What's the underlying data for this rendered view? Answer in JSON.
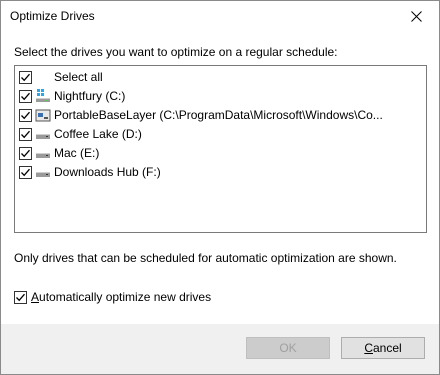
{
  "window": {
    "title": "Optimize Drives"
  },
  "dialog": {
    "instruction": "Select the drives you want to optimize on a regular schedule:",
    "select_all": {
      "label": "Select all",
      "checked": true
    },
    "drives": [
      {
        "label": "Nightfury (C:)",
        "icon": "windows-drive-icon",
        "checked": true
      },
      {
        "label": "PortableBaseLayer (C:\\ProgramData\\Microsoft\\Windows\\Co...",
        "icon": "portable-drive-icon",
        "checked": true
      },
      {
        "label": "Coffee Lake (D:)",
        "icon": "hard-drive-icon",
        "checked": true
      },
      {
        "label": "Mac (E:)",
        "icon": "hard-drive-icon",
        "checked": true
      },
      {
        "label": "Downloads Hub (F:)",
        "icon": "hard-drive-icon",
        "checked": true
      }
    ],
    "note": "Only drives that can be scheduled for automatic optimization are shown.",
    "auto_optimize": {
      "label_mnemonic": "A",
      "label_rest": "utomatically optimize new drives",
      "checked": true
    }
  },
  "buttons": {
    "ok": {
      "label": "OK",
      "enabled": false
    },
    "cancel_mnemonic": "C",
    "cancel_rest": "ancel"
  },
  "colors": {
    "accent": "#000000",
    "footer_bg": "#f0f0f0",
    "disabled_text": "#a0a0a0"
  }
}
